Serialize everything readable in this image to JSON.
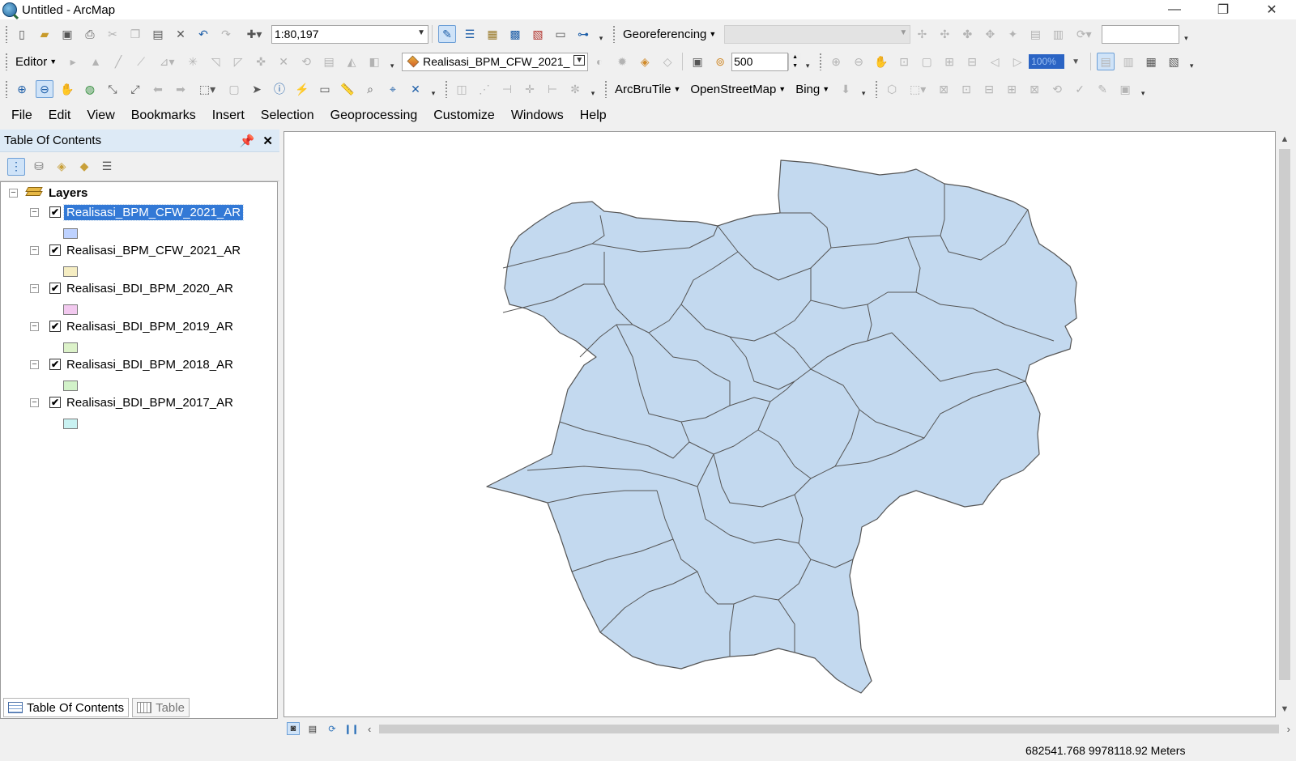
{
  "window": {
    "title": "Untitled - ArcMap",
    "controls": [
      "—",
      "❐",
      "✕"
    ]
  },
  "toolbar": {
    "scale": "1:80,197",
    "georeferencing_label": "Georeferencing",
    "editor_label": "Editor",
    "target_layer": "Realisasi_BPM_CFW_2021_",
    "zoom_value": "500",
    "zoom_percent": "100%",
    "arcbrutile_label": "ArcBruTile",
    "osm_label": "OpenStreetMap",
    "bing_label": "Bing"
  },
  "menu": [
    "File",
    "Edit",
    "View",
    "Bookmarks",
    "Insert",
    "Selection",
    "Geoprocessing",
    "Customize",
    "Windows",
    "Help"
  ],
  "toc": {
    "title": "Table Of Contents",
    "root_label": "Layers",
    "layers": [
      {
        "name": "Realisasi_BPM_CFW_2021_AR",
        "color": "#bed2ff",
        "checked": "✔",
        "selected": true
      },
      {
        "name": "Realisasi_BPM_CFW_2021_AR",
        "color": "#f5edc2",
        "checked": "✔",
        "selected": false
      },
      {
        "name": "Realisasi_BDI_BPM_2020_AR",
        "color": "#f2c9ef",
        "checked": "✔",
        "selected": false
      },
      {
        "name": "Realisasi_BDI_BPM_2019_AR",
        "color": "#dcf2c9",
        "checked": "✔",
        "selected": false
      },
      {
        "name": "Realisasi_BDI_BPM_2018_AR",
        "color": "#d2f2c9",
        "checked": "✔",
        "selected": false
      },
      {
        "name": "Realisasi_BDI_BPM_2017_AR",
        "color": "#c9f2f2",
        "checked": "✔",
        "selected": false
      }
    ],
    "tabs": [
      "Table Of Contents",
      "Table"
    ]
  },
  "map": {
    "fill_color": "#c3d9ef",
    "stroke_color": "#555555"
  },
  "status": {
    "coordinates": "682541.768  9978118.92 Meters"
  }
}
